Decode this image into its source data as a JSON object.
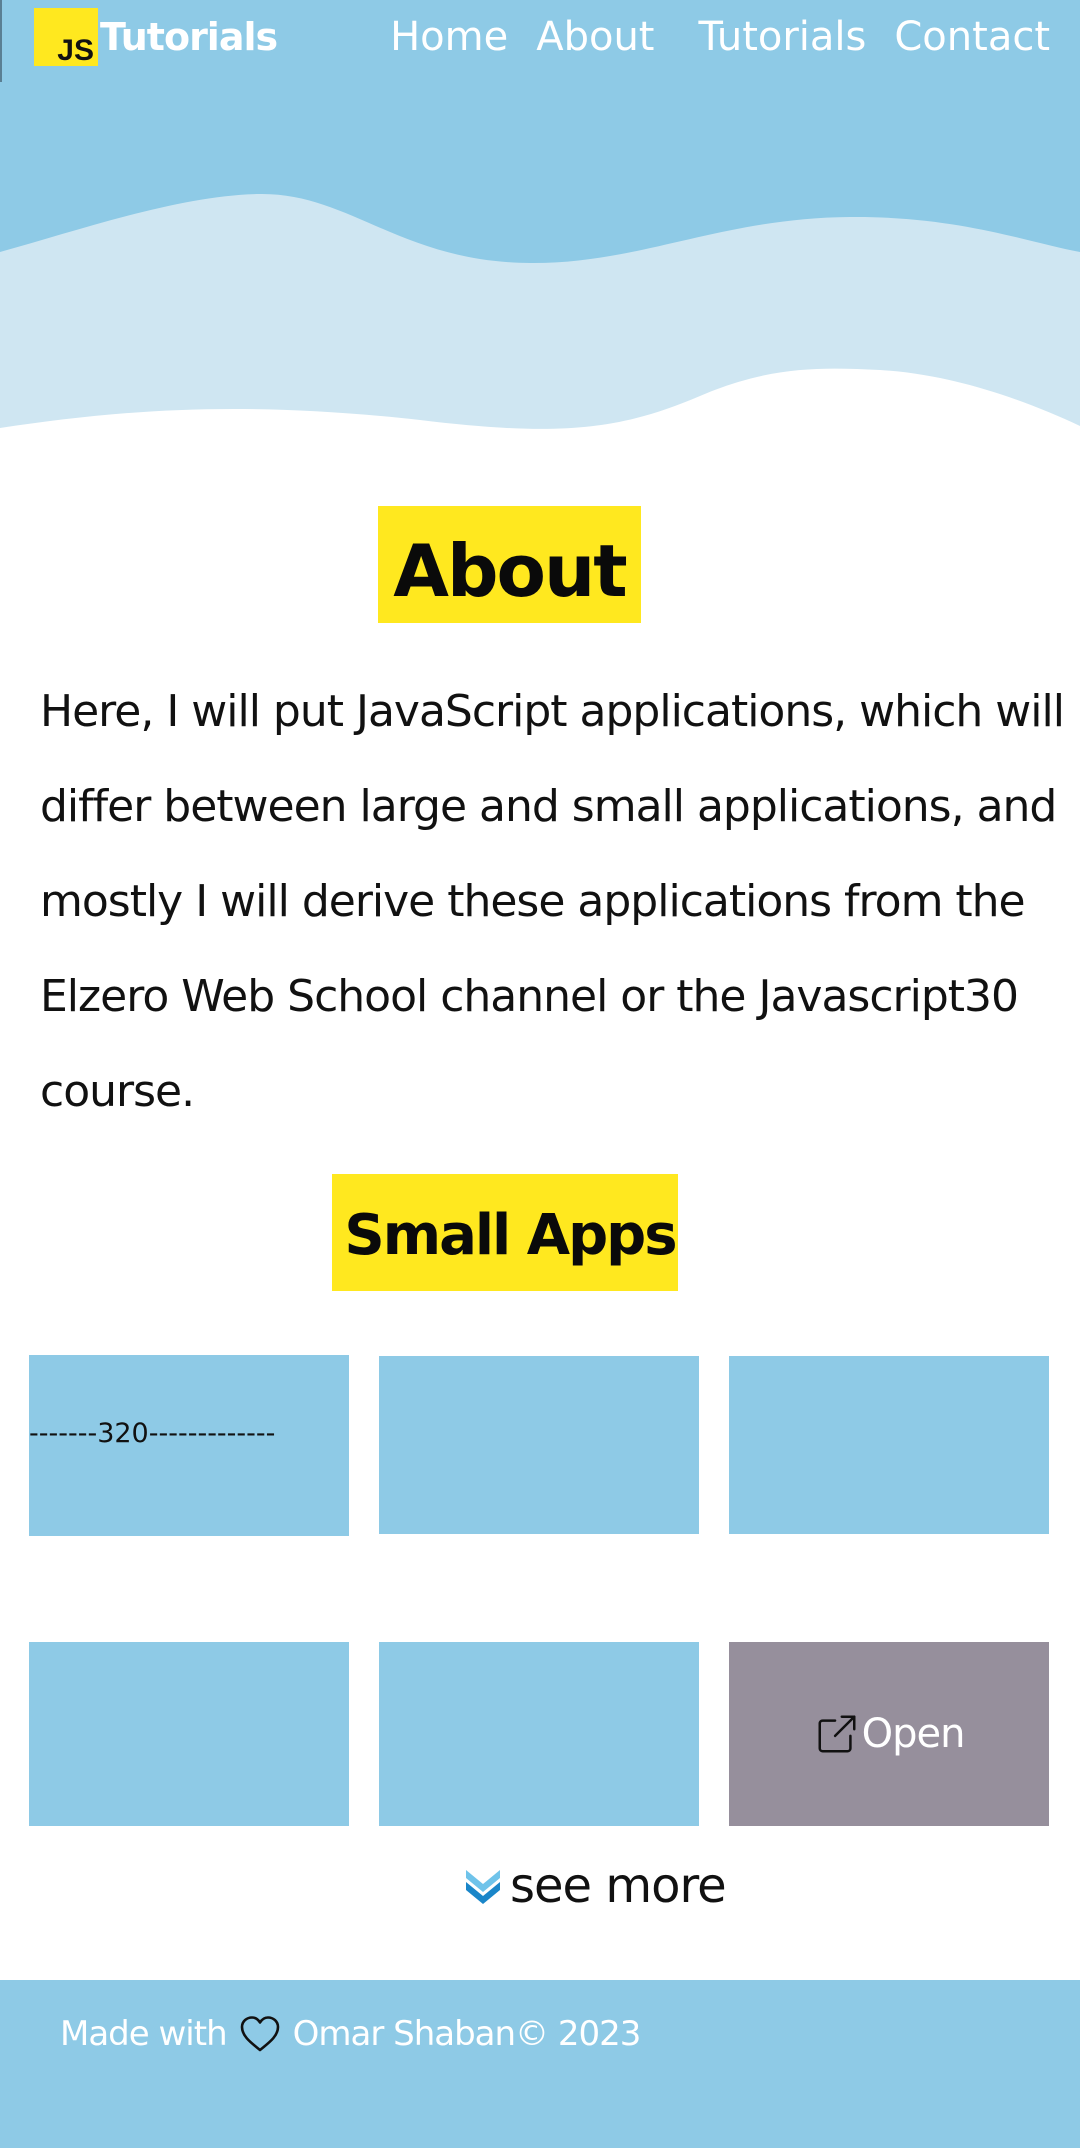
{
  "header": {
    "logo_badge": "JS",
    "logo_text": "Tutorials",
    "nav": [
      "Home",
      "About",
      "Tutorials",
      "Contact"
    ]
  },
  "about": {
    "title": "About",
    "text": "Here, I will put JavaScript applications, which will differ between large and small applications, and mostly I will derive these applications from the Elzero Web School channel or the Javascript30 course."
  },
  "small_apps": {
    "title": "Small Apps",
    "cards": [
      {
        "text": "-------320-------------"
      },
      {
        "text": ""
      },
      {
        "text": ""
      },
      {
        "text": ""
      },
      {
        "text": ""
      },
      {
        "text": "Open",
        "icon": "external-link-icon"
      }
    ],
    "see_more": "see more",
    "see_more_icon": "double-chevron-down-icon"
  },
  "footer": {
    "made_with": "Made with",
    "heart_icon": "heart-icon",
    "credit": "Omar Shaban© 2023"
  },
  "colors": {
    "primary_blue": "#8ecae6",
    "light_wave": "#cfe6f2",
    "accent_yellow": "#ffe81f",
    "card_hover": "#968f9c",
    "text_dark": "#111111",
    "text_light": "#ffffff"
  }
}
